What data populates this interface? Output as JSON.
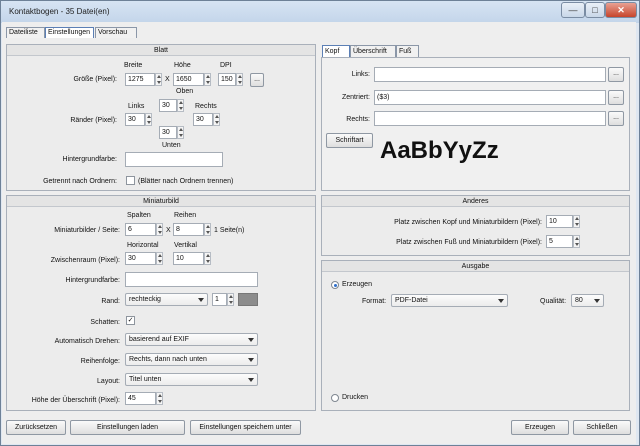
{
  "window": {
    "title": "Kontaktbogen - 35 Datei(en)",
    "minimize": "—",
    "maximize": "□",
    "close": "✕"
  },
  "tabs": [
    "Dateiliste",
    "Einstellungen",
    "Vorschau"
  ],
  "blatt": {
    "title": "Blatt",
    "size_label": "Größe (Pixel):",
    "breite_label": "Breite",
    "hoehe_label": "Höhe",
    "dpi_label": "DPI",
    "breite": "1275",
    "x": "X",
    "hoehe": "1650",
    "dpi": "150",
    "more": "...",
    "oben_label": "Oben",
    "links_label": "Links",
    "rechts_label": "Rechts",
    "unten_label": "Unten",
    "raender_label": "Ränder (Pixel):",
    "oben": "30",
    "links": "30",
    "rechts": "30",
    "unten": "30",
    "bg_label": "Hintergrundfarbe:",
    "getrennt_label": "Getrennt nach Ordnern:",
    "getrennt_text": "(Blätter nach Ordnern trennen)"
  },
  "kopf": {
    "tabs": [
      "Kopf",
      "Überschrift",
      "Fuß"
    ],
    "links_label": "Links:",
    "links_value": "",
    "zentriert_label": "Zentriert:",
    "zentriert_value": "($3)",
    "rechts_label": "Rechts:",
    "rechts_value": "",
    "more": "...",
    "font_button": "Schriftart",
    "font_preview": "AaBbYyZz"
  },
  "miniaturbild": {
    "title": "Miniaturbild",
    "spalten_label": "Spalten",
    "reihen_label": "Reihen",
    "per_page_label": "Miniaturbilder / Seite:",
    "spalten": "6",
    "x": "X",
    "reihen": "8",
    "seiten": "1 Seite(n)",
    "horizontal_label": "Horizontal",
    "vertikal_label": "Vertikal",
    "zwischen_label": "Zwischenraum (Pixel):",
    "horizontal": "30",
    "vertikal": "10",
    "bg_label": "Hintergrundfarbe:",
    "rand_label": "Rand:",
    "rand_value": "rechteckig",
    "rand_width": "1",
    "rand_color": "#8c8c8c",
    "schatten_label": "Schatten:",
    "schatten_check": "✓",
    "drehen_label": "Automatisch Drehen:",
    "drehen_value": "basierend auf EXIF",
    "reihenfolge_label": "Reihenfolge:",
    "reihenfolge_value": "Rechts, dann nach unten",
    "layout_label": "Layout:",
    "layout_value": "Titel unten",
    "ueberschrift_label": "Höhe der Überschrift (Pixel):",
    "ueberschrift_value": "45"
  },
  "anderes": {
    "title": "Anderes",
    "kopf_label": "Platz zwischen Kopf und Miniaturbildern (Pixel):",
    "kopf_value": "10",
    "fuss_label": "Platz zwischen Fuß und Miniaturbildern (Pixel):",
    "fuss_value": "5"
  },
  "ausgabe": {
    "title": "Ausgabe",
    "erzeugen_label": "Erzeugen",
    "format_label": "Format:",
    "format_value": "PDF-Datei",
    "qualitaet_label": "Qualität:",
    "qualitaet_value": "80",
    "drucken_label": "Drucken"
  },
  "footer": {
    "reset": "Zurücksetzen",
    "laden": "Einstellungen laden",
    "speichern": "Einstellungen speichern unter",
    "erzeugen": "Erzeugen",
    "schliessen": "Schließen"
  }
}
